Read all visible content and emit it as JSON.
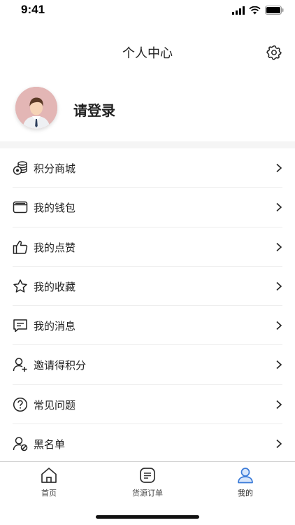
{
  "status_bar": {
    "time": "9:41"
  },
  "nav": {
    "title": "个人中心",
    "settings_icon": "gear-icon"
  },
  "profile": {
    "login_text": "请登录",
    "avatar": "avatar"
  },
  "menu": [
    {
      "label": "积分商城",
      "icon": "coins-icon"
    },
    {
      "label": "我的钱包",
      "icon": "wallet-icon"
    },
    {
      "label": "我的点赞",
      "icon": "thumbs-up-icon"
    },
    {
      "label": "我的收藏",
      "icon": "star-icon"
    },
    {
      "label": "我的消息",
      "icon": "message-icon"
    },
    {
      "label": "邀请得积分",
      "icon": "user-add-icon"
    },
    {
      "label": "常见问题",
      "icon": "question-icon"
    },
    {
      "label": "黑名单",
      "icon": "user-block-icon"
    }
  ],
  "tabbar": {
    "tabs": [
      {
        "label": "首页",
        "icon": "home-icon"
      },
      {
        "label": "货源订单",
        "icon": "order-list-icon"
      },
      {
        "label": "我的",
        "icon": "person-icon",
        "active": true
      }
    ],
    "active_color": "#3b7bd8"
  }
}
